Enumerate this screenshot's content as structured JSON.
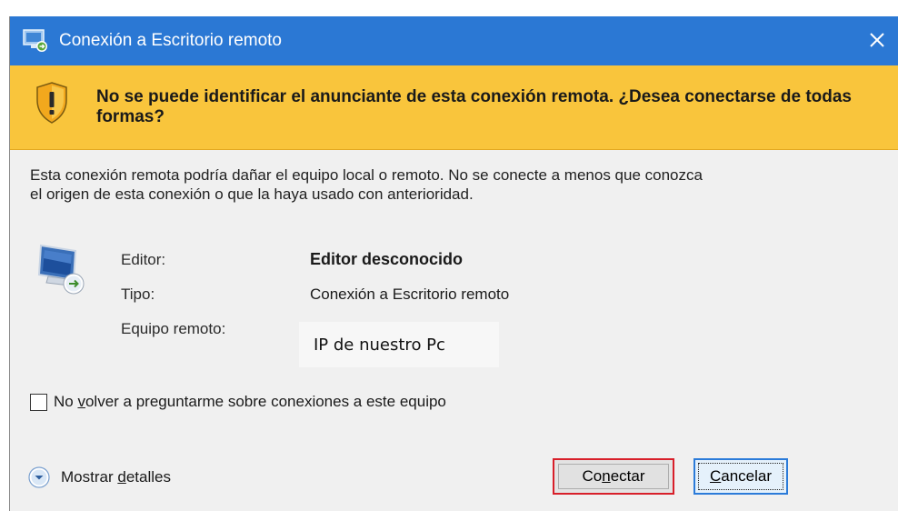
{
  "window": {
    "title": "Conexión a Escritorio remoto",
    "title_icon": "remote-desktop-icon",
    "close_icon": "close-icon"
  },
  "warning": {
    "icon": "shield-warning-icon",
    "text": "No se puede identificar el anunciante de esta conexión remota. ¿Desea conectarse de todas formas?"
  },
  "description": {
    "line1": "Esta conexión remota podría dañar el equipo local o remoto. No se conecte a menos que conozca",
    "line2": "el origen de esta conexión o que la haya usado con anterioridad."
  },
  "info": {
    "icon": "remote-computer-icon",
    "editor_label": "Editor:",
    "editor_value": "Editor desconocido",
    "type_label": "Tipo:",
    "type_value": "Conexión a Escritorio remoto",
    "remote_label": "Equipo remoto:",
    "remote_value": "IP de nuestro Pc"
  },
  "checkbox": {
    "label_prefix": "No ",
    "label_underlined": "v",
    "label_rest": "olver a preguntarme sobre conexiones a este equipo",
    "checked": false
  },
  "details": {
    "icon": "chevron-down-circle-icon",
    "label_prefix": "Mostrar ",
    "label_underlined": "d",
    "label_rest": "etalles"
  },
  "buttons": {
    "connect": {
      "prefix": "Co",
      "underlined": "n",
      "rest": "ectar"
    },
    "cancel": {
      "prefix": "",
      "underlined": "C",
      "rest": "ancelar"
    }
  },
  "colors": {
    "titlebar": "#2b78d4",
    "banner": "#f9c53c",
    "dialog_bg": "#f0f0f0",
    "highlight_border": "#d81f2a",
    "default_button_border": "#2b7bd9"
  }
}
